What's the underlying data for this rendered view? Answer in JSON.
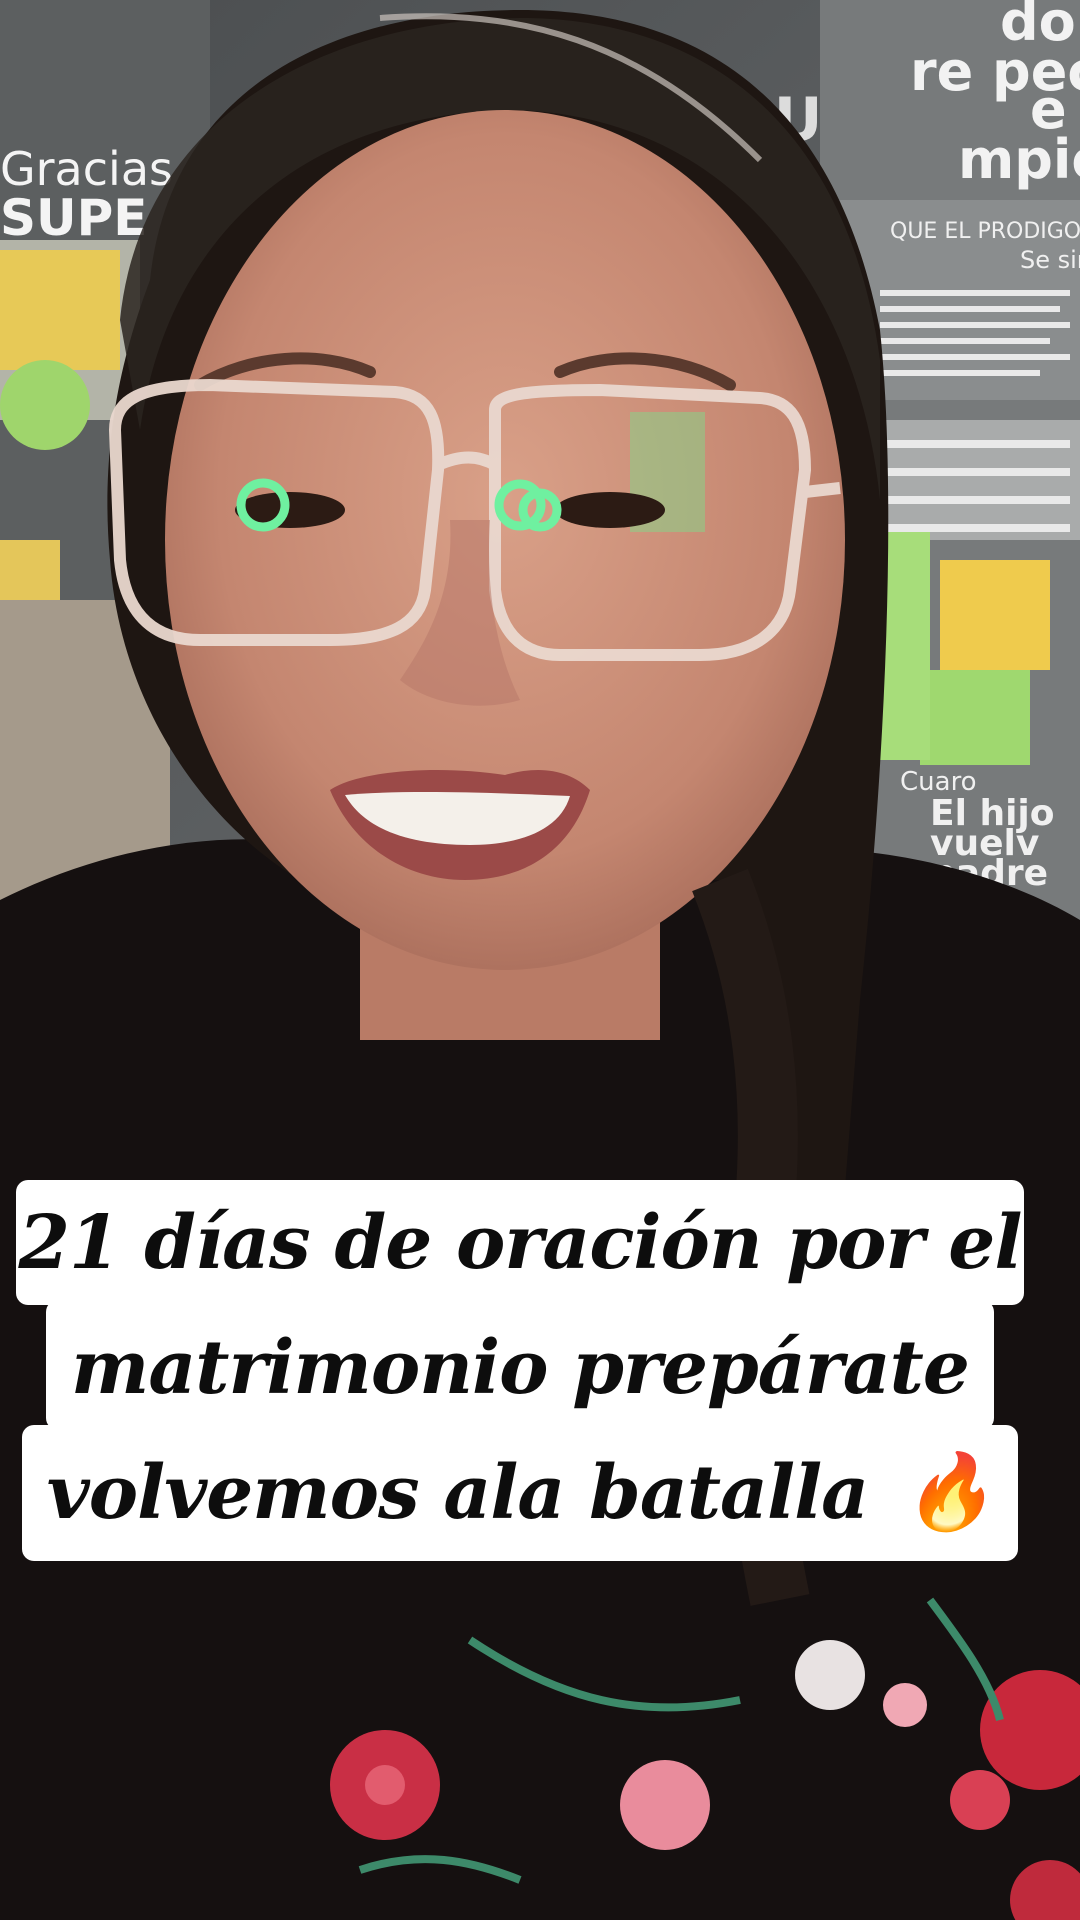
{
  "caption": {
    "line1": "21 días de oración por el",
    "line2": "matrimonio prepárate",
    "line3": "volvemos ala batalla",
    "emoji": "🔥"
  },
  "poster_text": {
    "top_right_1": "do el",
    "top_right_2": "re peco,",
    "top_right_3": "e",
    "top_right_4": "mpió.",
    "left_1": "Gracias a",
    "left_2": "SUPE",
    "heading_bu": "BU",
    "right_card_title": "QUE EL PRODIGO",
    "right_card_sub": "Se sin",
    "bottom_right_1": "Cuaro",
    "bottom_right_2": "El hijo",
    "bottom_right_3": "vuelv",
    "bottom_right_4": "padre"
  },
  "colors": {
    "caption_bg": "#ffffff",
    "caption_text": "#0d0d0d",
    "shirt": "#141010",
    "skin": "#c98d74",
    "hair": "#1c1410",
    "sticky_yellow": "#f2cf4a",
    "sticky_green": "#9bd96b"
  }
}
